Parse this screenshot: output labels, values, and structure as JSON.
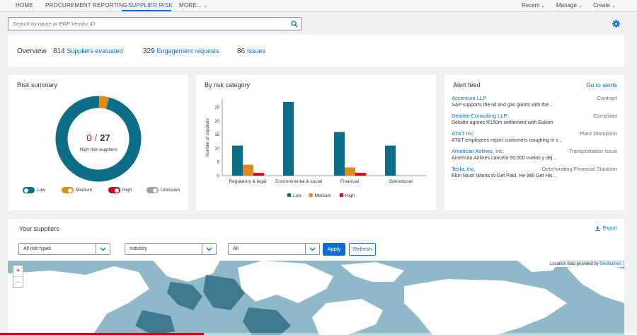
{
  "nav": {
    "tabs": [
      "HOME",
      "PROCUREMENT REPORTING",
      "SUPPLIER RISK",
      "MORE..."
    ],
    "active_tab": "SUPPLIER RISK",
    "right": [
      "Recent",
      "Manage",
      "Create"
    ]
  },
  "search": {
    "placeholder": "Search by name or ERP Vendor ID"
  },
  "overview": {
    "label": "Overview",
    "suppliers_count": "814",
    "suppliers_label": "Suppliers evaluated",
    "engagement_count": "329",
    "engagement_label": "Engagement requests",
    "issues_count": "86",
    "issues_label": "Issues"
  },
  "risk_summary": {
    "title": "Risk summary",
    "high_count": "0",
    "total": "27",
    "subtitle": "High risk suppliers",
    "donut": {
      "low": 26,
      "medium": 1,
      "high": 0
    },
    "toggles": [
      {
        "label": "Low",
        "color": "#0e6e87"
      },
      {
        "label": "Medium",
        "color": "#e08a1e"
      },
      {
        "label": "High",
        "color": "#d0021b"
      },
      {
        "label": "Unknown",
        "color": "#a0a0a0"
      }
    ]
  },
  "chart_data": {
    "type": "bar",
    "title": "By risk category",
    "ylabel": "Number of suppliers",
    "xlabel": "",
    "ylim": [
      0,
      25
    ],
    "yticks": [
      0,
      5,
      10,
      15,
      20,
      25
    ],
    "categories": [
      "Regulatory & legal",
      "Environmental & social",
      "Financial",
      "Operational"
    ],
    "series": [
      {
        "name": "Low",
        "color": "#0e6e87",
        "values": [
          11,
          27,
          16,
          11
        ]
      },
      {
        "name": "Medium",
        "color": "#e08a1e",
        "values": [
          4,
          0,
          3,
          0
        ]
      },
      {
        "name": "High",
        "color": "#d0021b",
        "values": [
          1,
          0,
          1,
          0
        ]
      }
    ]
  },
  "alert_feed": {
    "title": "Alert feed",
    "link": "Go to alerts",
    "items": [
      {
        "name": "Accenture LLP",
        "category": "Contract",
        "desc": "SAP supports the oil and gas giants with the .."
      },
      {
        "name": "Deloitte Consulting LLP",
        "category": "Complaint",
        "desc": "Deloitte agrees R150m settlement with Eskom"
      },
      {
        "name": "AT&T Inc.",
        "category": "Plant Disruption",
        "desc": "AT&T employees report customers coughing in s .."
      },
      {
        "name": "American Airlines, Inc.",
        "category": "Transportation Issue",
        "desc": "American Airlines cancela 55,000 vuelos y dej .."
      },
      {
        "name": "Tesla, Inc.",
        "category": "Deteriorating Financial Situation",
        "desc": "Elon Musk Wants to Get Paid. He Will Get His .."
      }
    ]
  },
  "suppliers": {
    "title": "Your suppliers",
    "export": "Export",
    "filters": {
      "risk_types": "All risk types",
      "industry": "Industry",
      "all": "All"
    },
    "apply": "Apply",
    "refresh": "Refresh",
    "attribution_prefix": "Location data provided by",
    "attribution_link": "GeoNames",
    "zoom_in": "+",
    "zoom_out": "–",
    "video_progress": 0.32
  }
}
